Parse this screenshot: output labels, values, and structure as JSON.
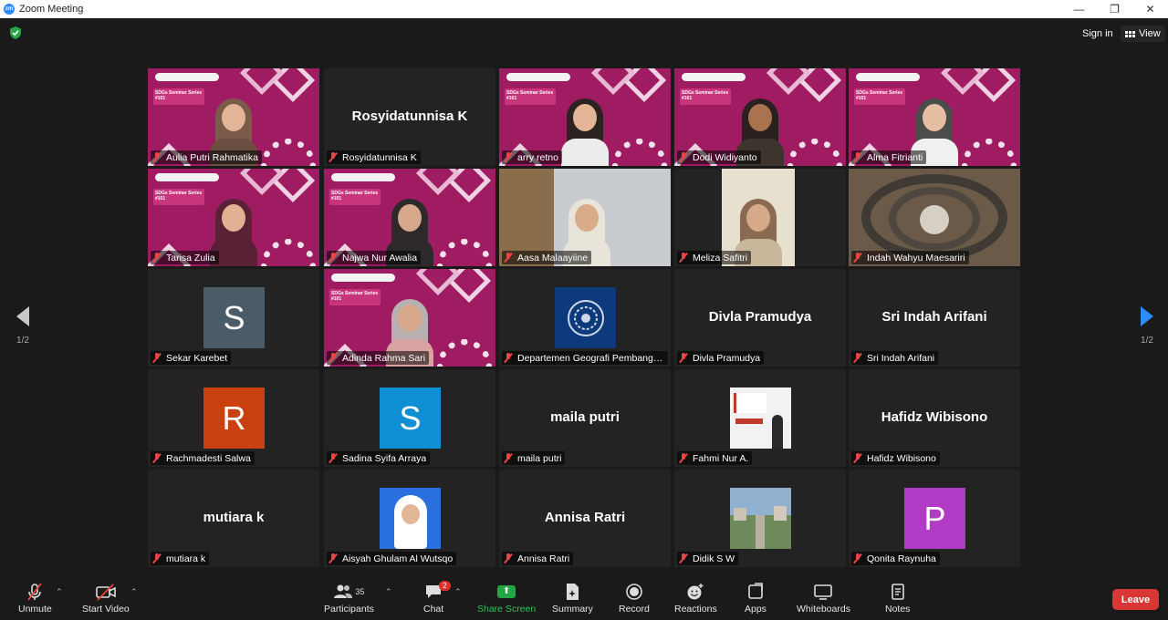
{
  "window": {
    "logo": "zm",
    "title": "Zoom Meeting",
    "minimize": "—",
    "restore": "❐",
    "close": "✕"
  },
  "top": {
    "sign_in": "Sign in",
    "view": "View"
  },
  "pager": {
    "page": "1/2"
  },
  "participants": [
    {
      "name": "Aulia Putri Rahmatika",
      "video": true,
      "skin": "#e3b495",
      "hijab": "#7a5a48",
      "body": "#6b4e40",
      "active": true
    },
    {
      "name": "Rosyidatunnisa K",
      "display": "Rosyidatunnisa K"
    },
    {
      "name": "arry retno",
      "video": true,
      "skin": "#e3b495",
      "hijab": "#2b2222",
      "body": "#ededed"
    },
    {
      "name": "Dodi Widiyanto",
      "video": true,
      "skin": "#a9734f",
      "hijab": "#2a2020",
      "body": "#3e342e"
    },
    {
      "name": "Alma Fitrianti",
      "video": true,
      "skin": "#e6bfa3",
      "hijab": "#4a4d4a",
      "body": "#f0f0f0"
    },
    {
      "name": "Tarisa Zulia",
      "video": true,
      "skin": "#e2b193",
      "hijab": "#5a2036",
      "body": "#5a2036"
    },
    {
      "name": "Najwa Nur Awalia",
      "video": true,
      "skin": "#d8a88c",
      "hijab": "#2e2a2c",
      "body": "#2e2a2c"
    },
    {
      "name": "Aasa Malaayiine",
      "video": "room",
      "skin": "#d9ab88",
      "hijab": "#e9e4da",
      "body": "#e9e4da"
    },
    {
      "name": "Meliza Safitri",
      "video": "photo",
      "skin": "#d6a98a",
      "hijab": "#8a6a50",
      "body": "#c9b79c"
    },
    {
      "name": "Indah Wahyu Maesariri",
      "video": "library"
    },
    {
      "name": "Sekar Karebet",
      "avatar": "S",
      "color": "#4a5c67"
    },
    {
      "name": "Adinda Rahma Sari",
      "video": true,
      "skin": "#d8a98a",
      "hijab": "#b8b0b0",
      "body": "#d9a3a1"
    },
    {
      "name": "Departemen Geografi Pembangunan",
      "logo": true
    },
    {
      "name": "Divla Pramudya",
      "display": "Divla Pramudya"
    },
    {
      "name": "Sri Indah Arifani",
      "display": "Sri Indah Arifani"
    },
    {
      "name": "Rachmadesti Salwa",
      "avatar": "R",
      "color": "#c8410e"
    },
    {
      "name": "Sadina Syifa Arraya",
      "avatar": "S",
      "color": "#0f8fd4"
    },
    {
      "name": "maila putri",
      "display": "maila putri"
    },
    {
      "name": "Fahmi Nur A.",
      "pic": "fahmi"
    },
    {
      "name": "Hafidz Wibisono",
      "display": "Hafidz Wibisono"
    },
    {
      "name": "mutiara k",
      "display": "mutiara k"
    },
    {
      "name": "Aisyah Ghulam Al Wutsqo",
      "pic": "aisyah"
    },
    {
      "name": "Annisa Ratri",
      "display": "Annisa Ratri"
    },
    {
      "name": "Didik S W",
      "pic": "city"
    },
    {
      "name": "Qonita Raynuha",
      "avatar": "P",
      "color": "#b13bc4"
    }
  ],
  "video_overlay": {
    "series": "SDGs Seminar Series #101"
  },
  "toolbar": {
    "unmute": "Unmute",
    "start_video": "Start Video",
    "participants": "Participants",
    "participants_count": "35",
    "chat": "Chat",
    "chat_badge": "2",
    "share_screen": "Share Screen",
    "summary": "Summary",
    "record": "Record",
    "reactions": "Reactions",
    "apps": "Apps",
    "whiteboards": "Whiteboards",
    "notes": "Notes",
    "leave": "Leave"
  },
  "colors": {
    "accent": "#2d8cff",
    "share": "#23a746",
    "leave": "#d93636",
    "active_border": "#e0e06a"
  }
}
